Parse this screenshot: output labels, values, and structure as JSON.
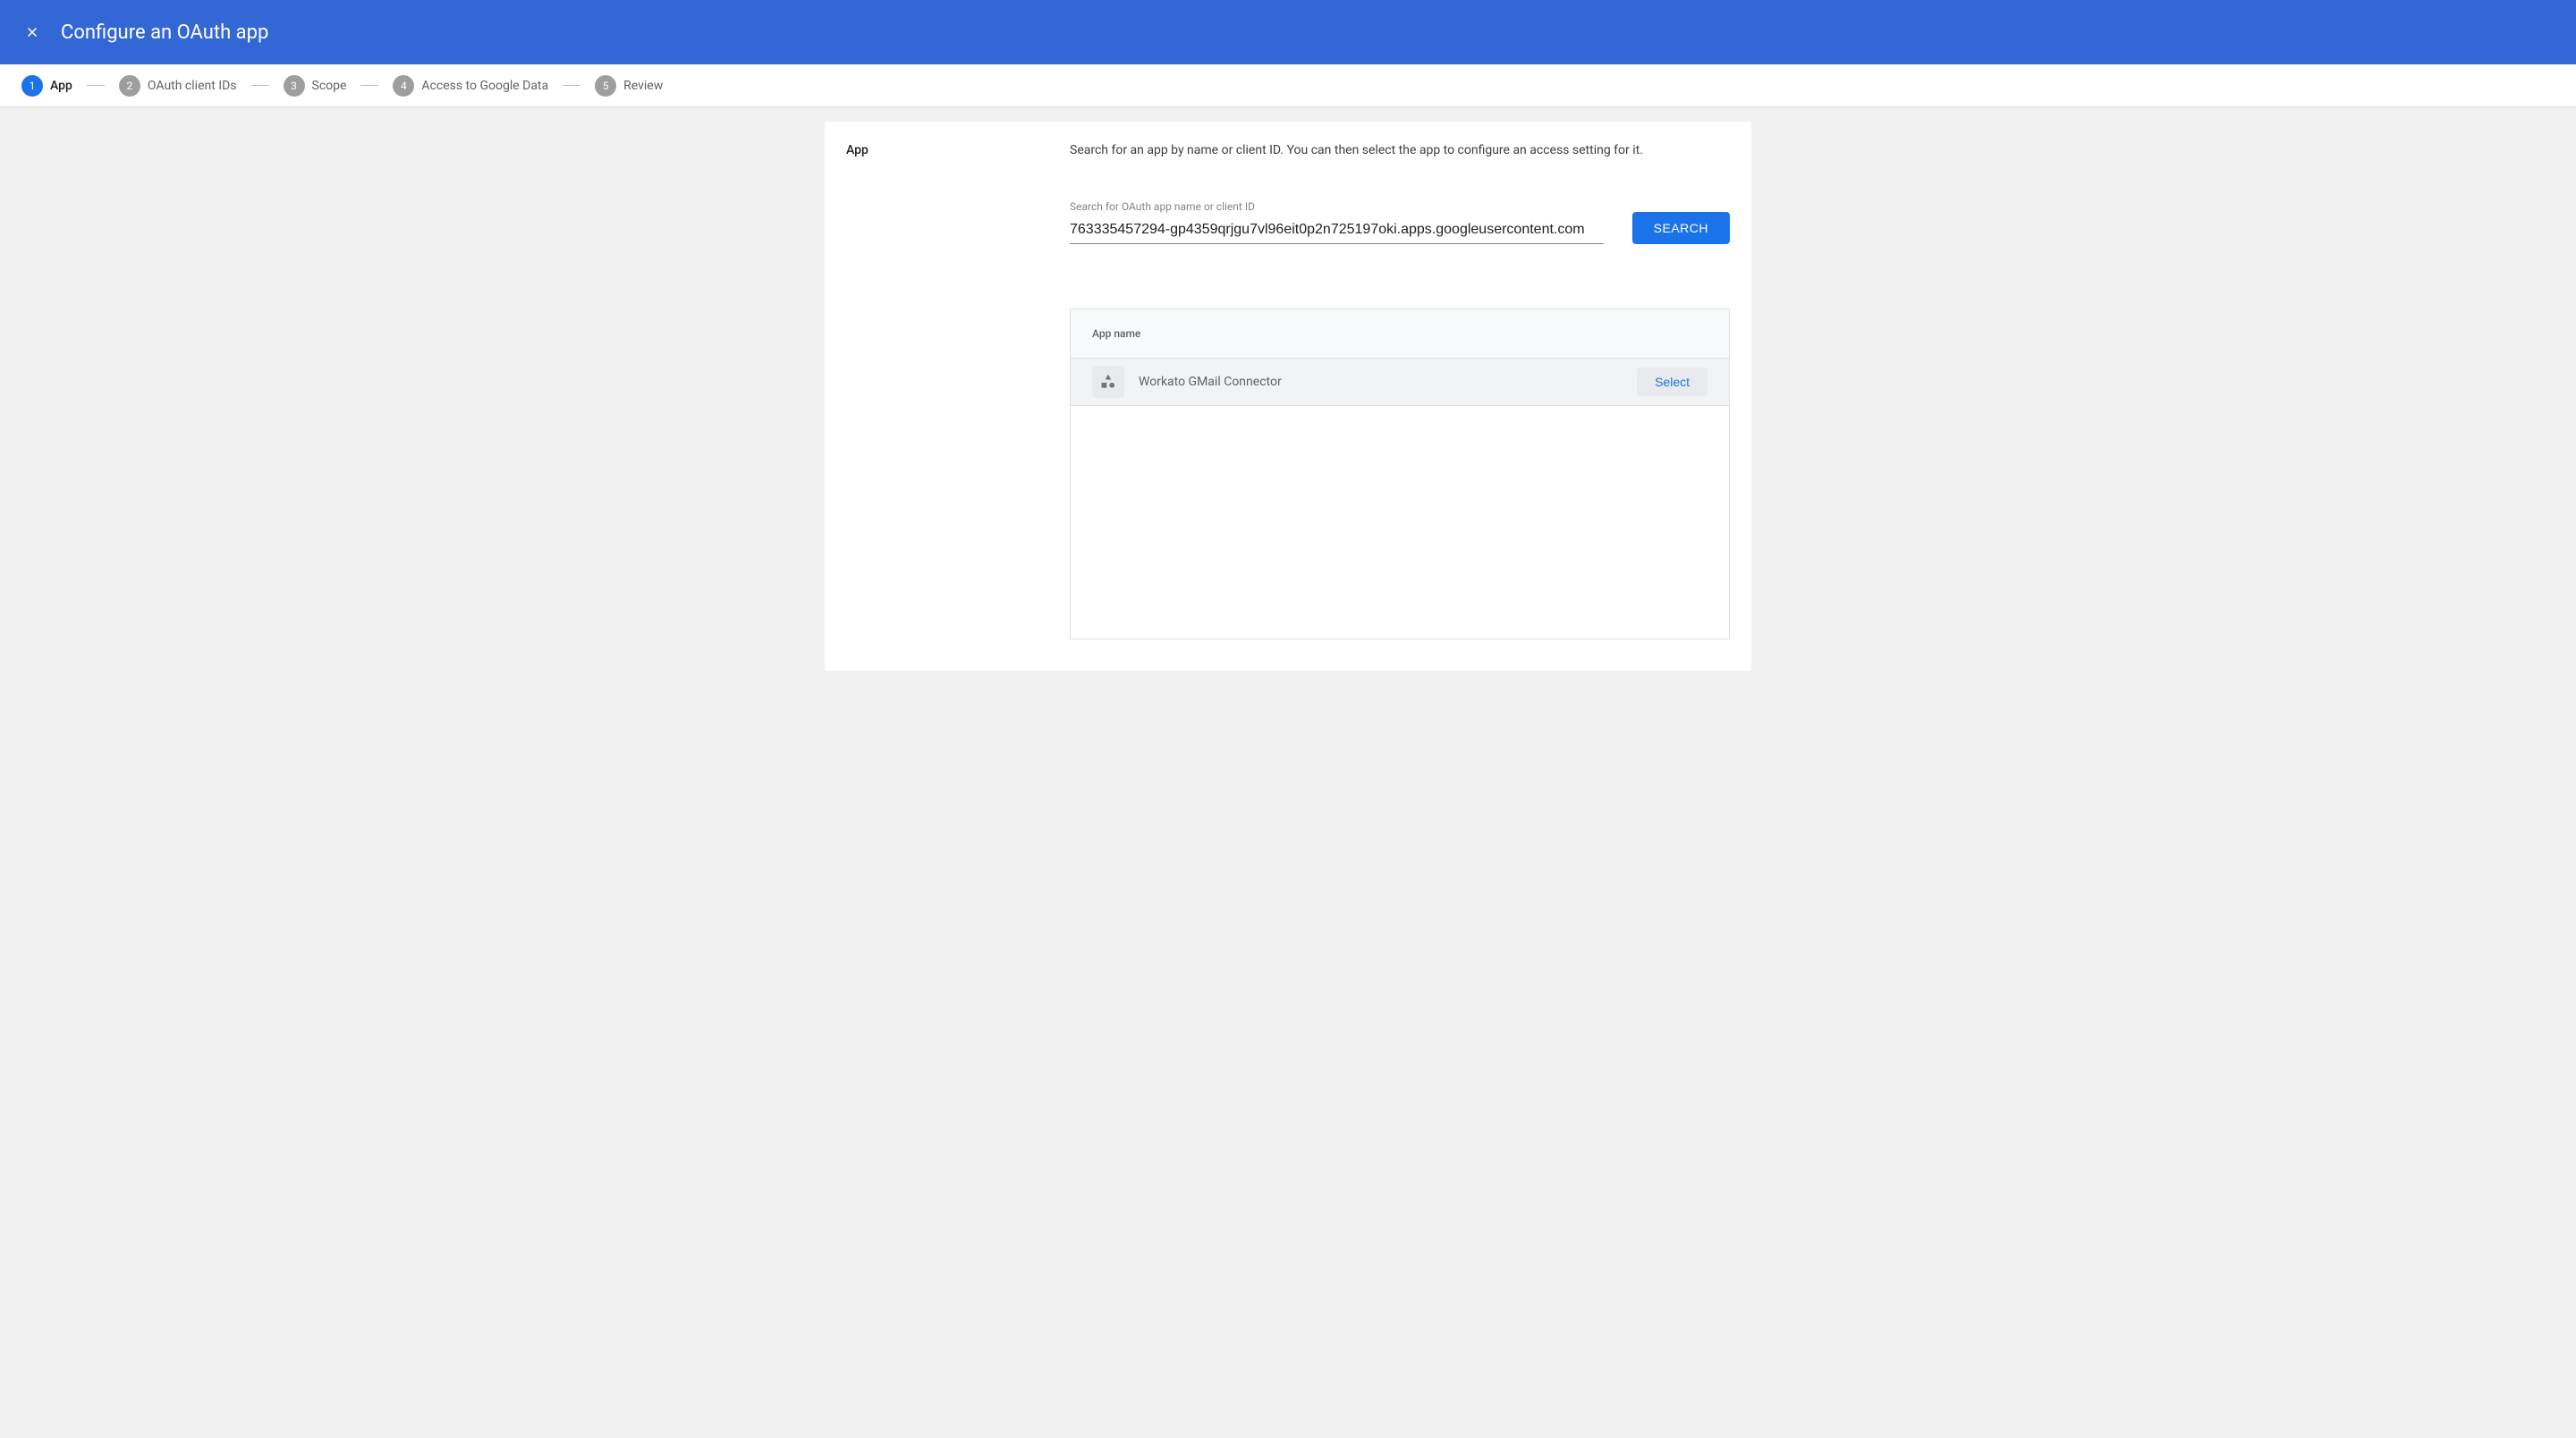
{
  "header": {
    "title": "Configure an OAuth app"
  },
  "stepper": {
    "steps": [
      {
        "number": "1",
        "label": "App",
        "active": true
      },
      {
        "number": "2",
        "label": "OAuth client IDs",
        "active": false
      },
      {
        "number": "3",
        "label": "Scope",
        "active": false
      },
      {
        "number": "4",
        "label": "Access to Google Data",
        "active": false
      },
      {
        "number": "5",
        "label": "Review",
        "active": false
      }
    ]
  },
  "content": {
    "sectionTitle": "App",
    "description": "Search for an app by name or client ID. You can then select the app to configure an access setting for it.",
    "searchLabel": "Search for OAuth app name or client ID",
    "searchValue": "763335457294-gp4359qrjgu7vl96eit0p2n725197oki.apps.googleusercontent.com",
    "searchButtonLabel": "SEARCH",
    "table": {
      "header": "App name",
      "rows": [
        {
          "name": "Workato GMail Connector",
          "selectLabel": "Select"
        }
      ]
    }
  }
}
